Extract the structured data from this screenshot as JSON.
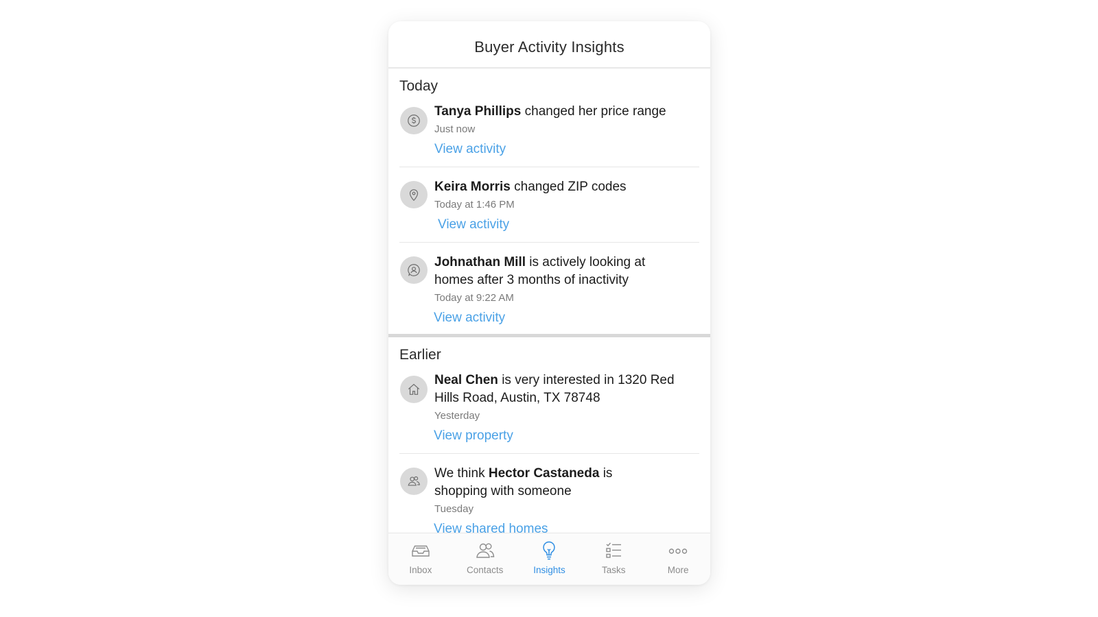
{
  "header": {
    "title": "Buyer Activity Insights"
  },
  "sections": {
    "today": {
      "title": "Today",
      "items": [
        {
          "icon": "dollar-icon",
          "name": "Tanya Phillips",
          "text": " changed her price range",
          "time": "Just now",
          "link": "View activity"
        },
        {
          "icon": "location-pin-icon",
          "name": "Keira Morris",
          "text": " changed ZIP codes",
          "time": "Today at 1:46 PM",
          "link": "View activity"
        },
        {
          "icon": "person-badge-icon",
          "name": "Johnathan Mill",
          "text": " is actively looking at homes after 3 months of inactivity",
          "time": "Today at 9:22 AM",
          "link": "View activity"
        }
      ]
    },
    "earlier": {
      "title": "Earlier",
      "items": [
        {
          "icon": "house-icon",
          "name": "Neal Chen",
          "text": " is very interested in 1320 Red Hills Road, Austin, TX 78748",
          "time": "Yesterday",
          "link": "View property"
        },
        {
          "icon": "people-icon",
          "prefix": "We think ",
          "name": "Hector Castaneda",
          "text": " is shopping with someone",
          "time": "Tuesday",
          "link": "View shared homes"
        }
      ]
    }
  },
  "tabbar": {
    "tabs": [
      {
        "label": "Inbox",
        "icon": "inbox-icon"
      },
      {
        "label": "Contacts",
        "icon": "contacts-icon"
      },
      {
        "label": "Insights",
        "icon": "lightbulb-icon",
        "active": true
      },
      {
        "label": "Tasks",
        "icon": "tasks-icon"
      },
      {
        "label": "More",
        "icon": "more-icon"
      }
    ]
  },
  "colors": {
    "accent": "#2f8ee3",
    "link": "#4aa1e6",
    "avatar_bg": "#d9d9d9",
    "divider": "#d8d8d8"
  }
}
